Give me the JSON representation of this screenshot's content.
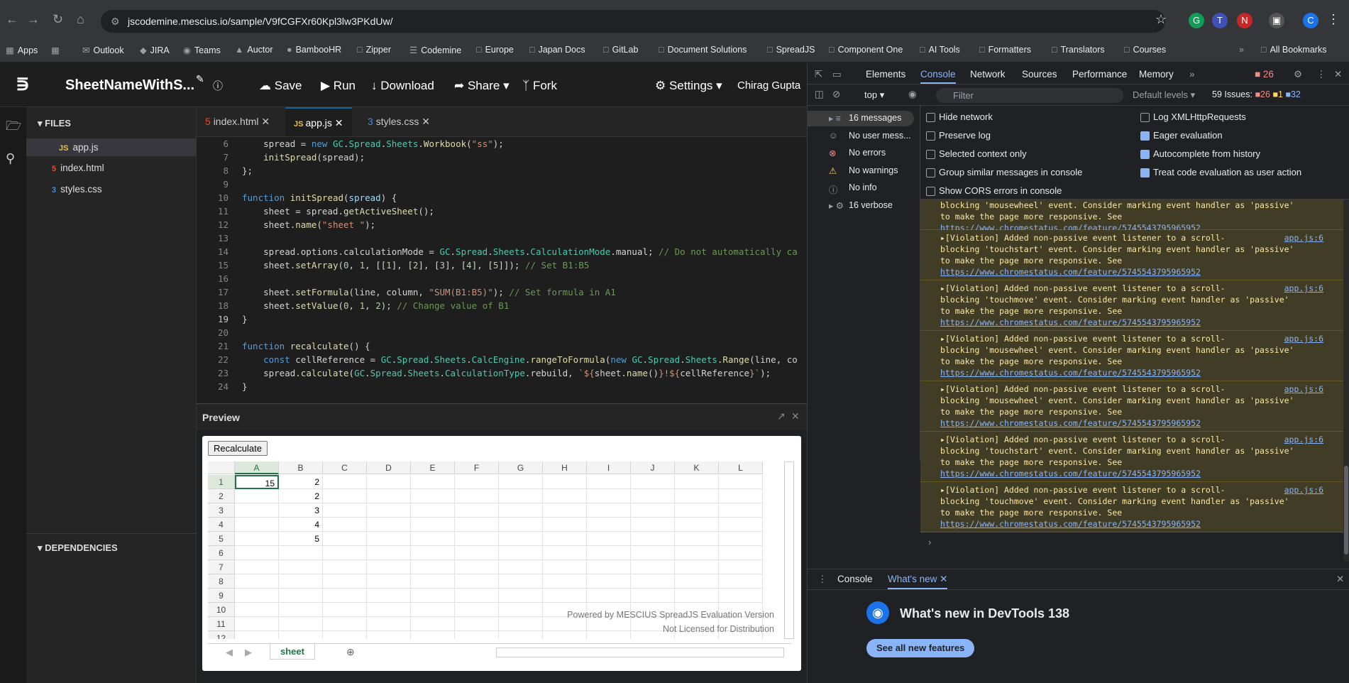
{
  "browser": {
    "url": "jscodemine.mescius.io/sample/V9fCGFXr60Kpl3lw3PKdUw/",
    "bookmarks": [
      "Apps",
      "Outlook",
      "JIRA",
      "Teams",
      "Auctor",
      "BambooHR",
      "Zipper",
      "Codemine",
      "Europe",
      "Japan Docs",
      "GitLab",
      "Document Solutions",
      "SpreadJS",
      "Component One",
      "AI Tools",
      "Formatters",
      "Translators",
      "Courses"
    ],
    "all_bookmarks": "All Bookmarks"
  },
  "app": {
    "title": "SheetNameWithS...",
    "buttons": {
      "save": "Save",
      "run": "Run",
      "download": "Download",
      "share": "Share",
      "fork": "Fork",
      "settings": "Settings"
    },
    "user": "Chirag Gupta"
  },
  "files": {
    "header": "FILES",
    "items": [
      "app.js",
      "index.html",
      "styles.css"
    ],
    "dependencies": "DEPENDENCIES"
  },
  "tabs": [
    "index.html",
    "app.js",
    "styles.css"
  ],
  "code_lines": [
    "6",
    "7",
    "8",
    "9",
    "10",
    "11",
    "12",
    "13",
    "14",
    "15",
    "16",
    "17",
    "18",
    "19",
    "20",
    "21",
    "22",
    "23",
    "24"
  ],
  "preview": {
    "title": "Preview",
    "button": "Recalculate",
    "columns": [
      "A",
      "B",
      "C",
      "D",
      "E",
      "F",
      "G",
      "H",
      "I",
      "J",
      "K",
      "L"
    ],
    "rows": [
      "1",
      "2",
      "3",
      "4",
      "5",
      "6",
      "7",
      "8",
      "9",
      "10",
      "11",
      "12"
    ],
    "colA": [
      "15",
      "",
      "",
      "",
      "",
      "",
      "",
      "",
      "",
      "",
      "",
      ""
    ],
    "colB": [
      "2",
      "2",
      "3",
      "4",
      "5",
      "",
      "",
      "",
      "",
      "",
      "",
      ""
    ],
    "watermark1": "Powered by MESCIUS SpreadJS Evaluation Version",
    "watermark2": "Not Licensed for Distribution",
    "sheet": "sheet"
  },
  "devtools": {
    "tabs": [
      "Elements",
      "Console",
      "Network",
      "Sources",
      "Performance",
      "Memory"
    ],
    "error_count": "26",
    "context": "top",
    "filter_placeholder": "Filter",
    "levels": "Default levels",
    "issues": "59 Issues:",
    "issue_counts": [
      "26",
      "1",
      "32"
    ],
    "side": [
      "16 messages",
      "No user mess...",
      "No errors",
      "No warnings",
      "No info",
      "16 verbose"
    ],
    "settings_left": [
      "Hide network",
      "Preserve log",
      "Selected context only",
      "Group similar messages in console",
      "Show CORS errors in console"
    ],
    "settings_right": [
      "Log XMLHttpRequests",
      "Eager evaluation",
      "Autocomplete from history",
      "Treat code evaluation as user action"
    ],
    "violations": [
      {
        "event": "touchstart"
      },
      {
        "event": "touchmove"
      },
      {
        "event": "mousewheel"
      },
      {
        "event": "mousewheel"
      },
      {
        "event": "touchstart"
      },
      {
        "event": "touchmove"
      }
    ],
    "violation_prefix": "[Violation] Added non-passive event listener to a scroll-",
    "violation_suffix": "to make the page more responsive. See",
    "violation_link": "https://www.chromestatus.com/feature/5745543795965952",
    "violation_src": "app.js:6",
    "first_partial": "blocking 'mousewheel' event. Consider marking event handler as 'passive'",
    "drawer_tabs": [
      "Console",
      "What's new"
    ],
    "whats_new": "What's new in DevTools 138",
    "see_all": "See all new features"
  }
}
